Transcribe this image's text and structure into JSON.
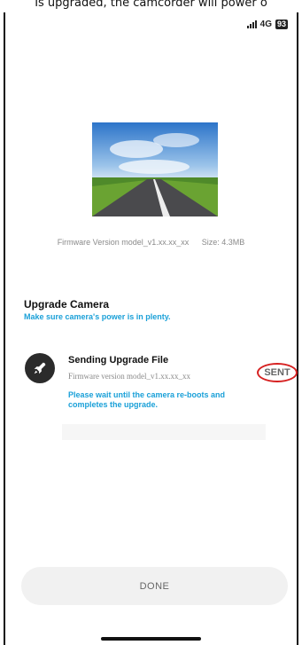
{
  "caption": "Is upgraded, the camcorder will power o",
  "status_bar": {
    "network": "4G",
    "battery": "93"
  },
  "firmware": {
    "version": "Firmware Version model_v1.xx.xx_xx",
    "size": "Size: 4.3MB"
  },
  "upgrade": {
    "title": "Upgrade Camera",
    "subtitle": "Make sure camera's power is in plenty."
  },
  "sending": {
    "title": "Sending Upgrade File",
    "version": "Firmware version model_v1.xx.xx_xx",
    "status": "SENT",
    "note": "Please wait until the camera re-boots and completes the upgrade."
  },
  "done_button": "DONE",
  "colors": {
    "accent": "#1aa0d8",
    "highlight": "#d62020"
  },
  "icons": [
    "signal-icon",
    "battery-icon",
    "rocket-icon"
  ]
}
